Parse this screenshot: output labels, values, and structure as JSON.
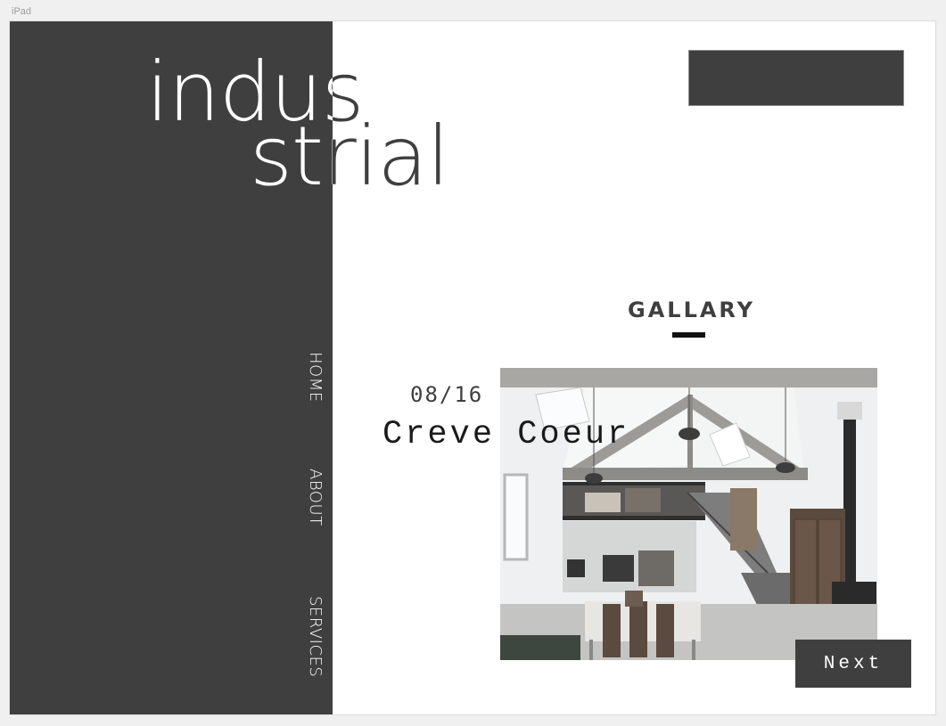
{
  "frame": {
    "label": "iPad"
  },
  "title": {
    "line1": "indus",
    "line2": "strial"
  },
  "nav": {
    "items": [
      {
        "label": "HOME"
      },
      {
        "label": "ABOUT"
      },
      {
        "label": "SERVICES"
      }
    ]
  },
  "gallery": {
    "heading": "GALLARY",
    "date": "08/16",
    "caption": "Creve Coeur",
    "next_label": "Next"
  },
  "colors": {
    "dark_panel": "#3f3f3f",
    "background": "#ffffff",
    "accent_underline": "#111111"
  }
}
